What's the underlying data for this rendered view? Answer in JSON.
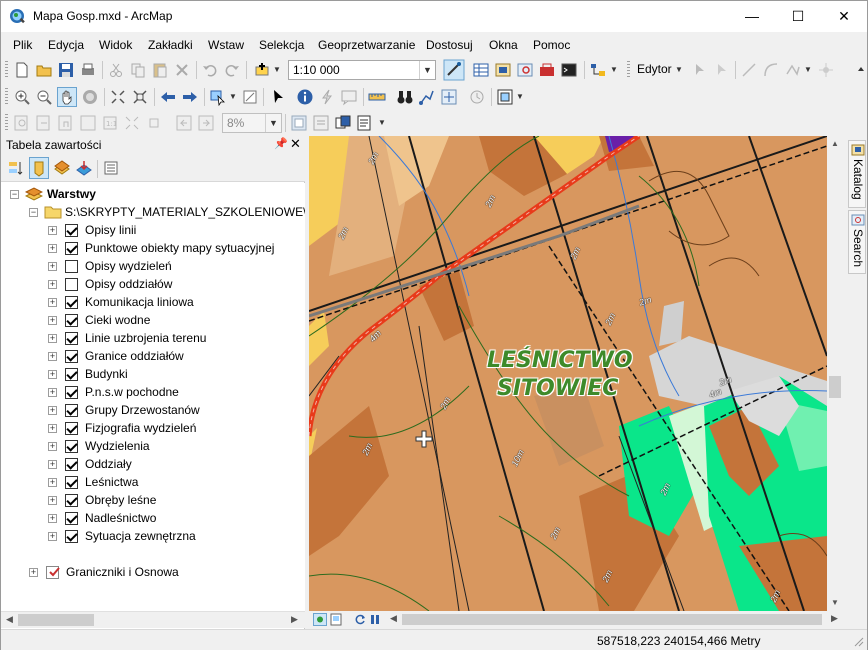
{
  "window": {
    "title": "Mapa Gosp.mxd - ArcMap",
    "minimize": "—",
    "maximize": "☐",
    "close": "✕"
  },
  "menu": [
    "Plik",
    "Edycja",
    "Widok",
    "Zakładki",
    "Wstaw",
    "Selekcja",
    "Geoprzetwarzanie",
    "Dostosuj",
    "Okna",
    "Pomoc"
  ],
  "toolbar": {
    "scale": "1:10 000",
    "editor_label": "Edytor",
    "zoom_percent": "8%"
  },
  "toc": {
    "title": "Tabela zawartości",
    "root_label": "Warstwy",
    "group_label": "S:\\SKRYPTY_MATERIALY_SZKOLENIOWE\\_AK",
    "layers": [
      {
        "name": "Opisy linii",
        "checked": true
      },
      {
        "name": "Punktowe obiekty mapy sytuacyjnej",
        "checked": true
      },
      {
        "name": "Opisy wydzieleń",
        "checked": false
      },
      {
        "name": "Opisy oddziałów",
        "checked": false
      },
      {
        "name": "Komunikacja liniowa",
        "checked": true
      },
      {
        "name": "Cieki wodne",
        "checked": true
      },
      {
        "name": "Linie uzbrojenia terenu",
        "checked": true
      },
      {
        "name": "Granice oddziałów",
        "checked": true
      },
      {
        "name": "Budynki",
        "checked": true
      },
      {
        "name": "P.n.s.w pochodne",
        "checked": true
      },
      {
        "name": "Grupy Drzewostanów",
        "checked": true
      },
      {
        "name": "Fizjografia wydzieleń",
        "checked": true
      },
      {
        "name": "Wydzielenia",
        "checked": true
      },
      {
        "name": "Oddziały",
        "checked": true
      },
      {
        "name": "Leśnictwa",
        "checked": true
      },
      {
        "name": "Obręby leśne",
        "checked": true
      },
      {
        "name": "Nadleśnictwo",
        "checked": true
      },
      {
        "name": "Sytuacja zewnętrzna",
        "checked": true
      }
    ],
    "extra_layer": "Graniczniki i Osnowa"
  },
  "map": {
    "forest_name_line1": "LEŚNICTWO",
    "forest_name_line2": "SITOWIEC",
    "road_label": "4m",
    "road_labels": [
      "2m",
      "2m",
      "2m",
      "2m",
      "2m",
      "2m",
      "10m",
      "2m",
      "2m",
      "4m",
      "2m",
      "2m",
      "2m",
      "2m",
      "2m"
    ]
  },
  "dock": {
    "catalog": "Katalog",
    "search": "Search"
  },
  "status": {
    "coordinates": "587518,223  240154,466 Metry"
  },
  "colors": {
    "stand_brown": "#d8975f",
    "stand_dark": "#c4743a",
    "stand_light": "#e3b07d",
    "yellow": "#f6cd5a",
    "green_bright": "#0ae68a",
    "green_light": "#d3f7d6",
    "road_red": "#e83a1a",
    "forest_label": "#3e8a2a"
  }
}
